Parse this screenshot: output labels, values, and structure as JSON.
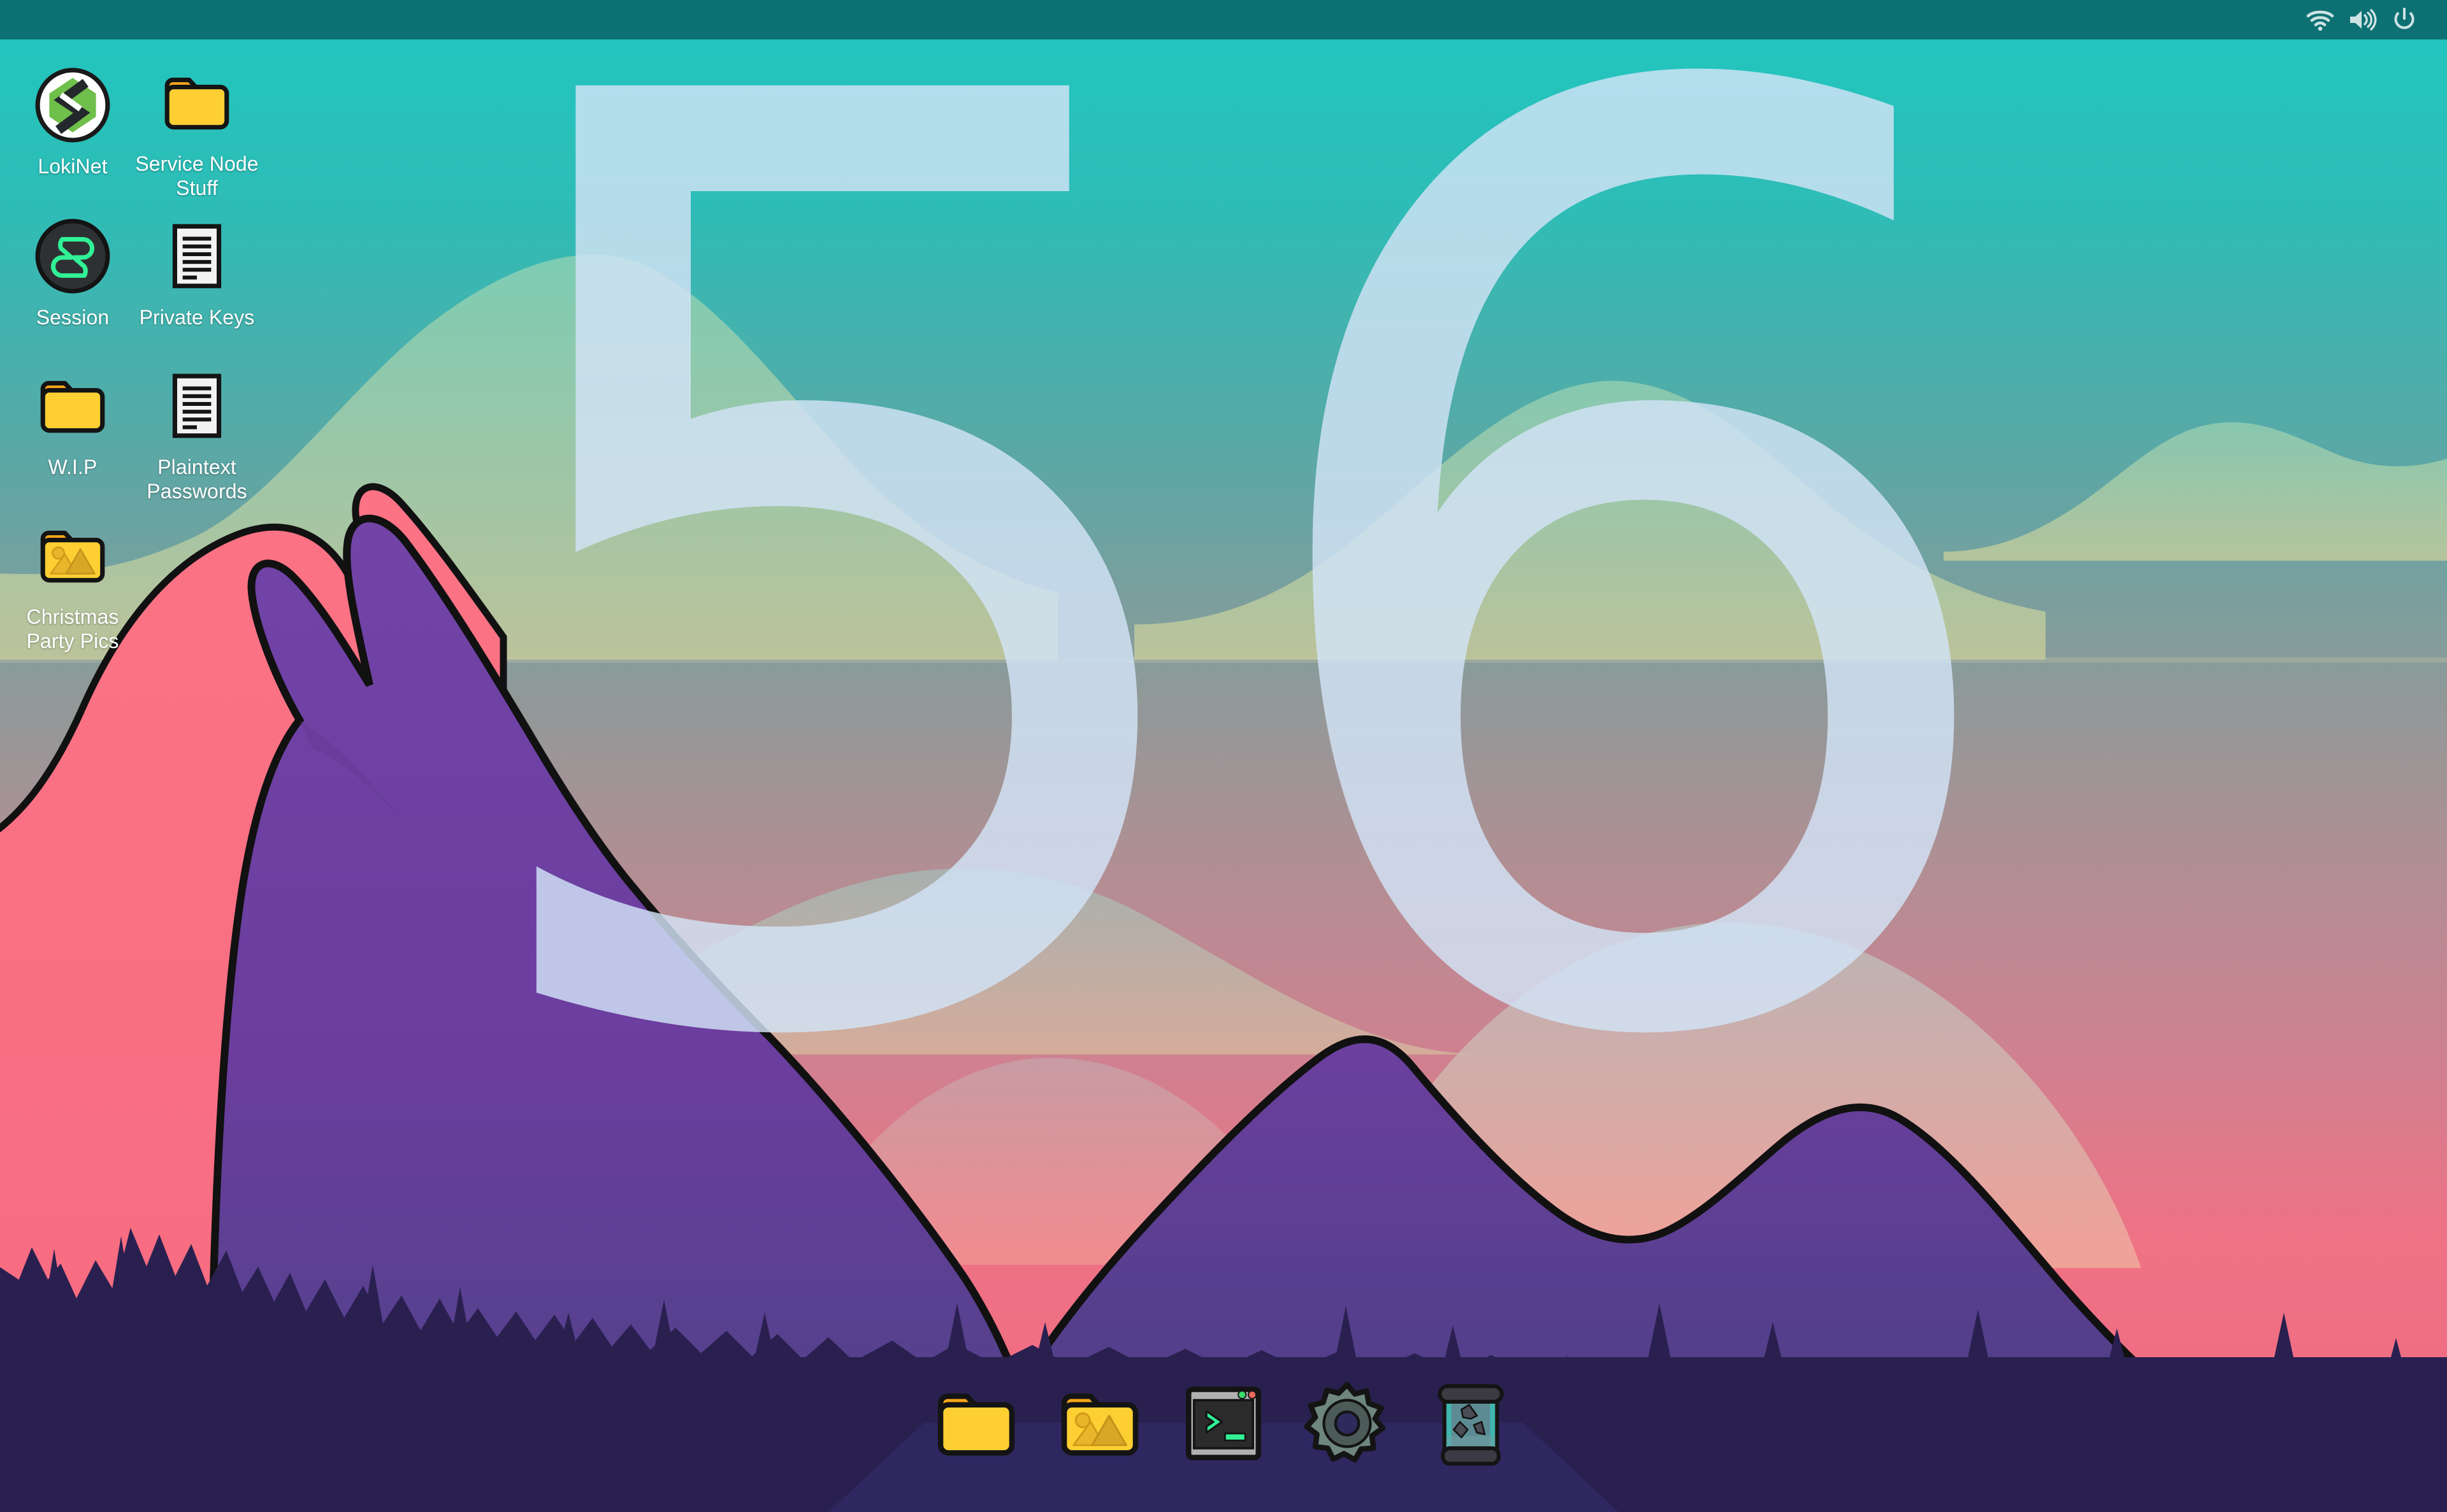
{
  "desktop": {
    "wallpaper_name": "retro-mountain-sunset",
    "overlay_number": "56",
    "colors": {
      "panel": "#0d7174",
      "sky_top": "#1fc7c0",
      "sky_mid": "#7fa2a6",
      "sky_bottom": "#f06c7e",
      "mountain_pink": "#fa7185",
      "mountain_purple": "#6b3d99",
      "forest": "#2a2050",
      "overlay_text": "#d3e4f7",
      "folder_yellow": "#fdcf33",
      "folder_tab": "#f9a61a",
      "accent_green": "#31f196",
      "lokinet_green": "#6fbf4b"
    }
  },
  "topbar": {
    "tray": [
      {
        "name": "wifi-icon",
        "label": "Network"
      },
      {
        "name": "volume-icon",
        "label": "Volume"
      },
      {
        "name": "power-icon",
        "label": "Power"
      }
    ]
  },
  "desktop_icons": [
    {
      "label": "LokiNet",
      "icon": "lokinet-app-icon",
      "col": 0,
      "row": 0
    },
    {
      "label": "Service Node Stuff",
      "icon": "folder-icon",
      "col": 1,
      "row": 0
    },
    {
      "label": "Session",
      "icon": "session-app-icon",
      "col": 0,
      "row": 1
    },
    {
      "label": "Private Keys",
      "icon": "document-icon",
      "col": 1,
      "row": 1
    },
    {
      "label": "W.I.P",
      "icon": "folder-icon",
      "col": 0,
      "row": 2
    },
    {
      "label": "Plaintext Passwords",
      "icon": "document-icon",
      "col": 1,
      "row": 2
    },
    {
      "label": "Christmas Party Pics",
      "icon": "pictures-folder-icon",
      "col": 0,
      "row": 3
    }
  ],
  "dock": {
    "items": [
      {
        "label": "Files",
        "icon": "folder-icon"
      },
      {
        "label": "Pictures",
        "icon": "pictures-folder-icon"
      },
      {
        "label": "Terminal",
        "icon": "terminal-icon"
      },
      {
        "label": "Settings",
        "icon": "gear-icon"
      },
      {
        "label": "Trash",
        "icon": "trash-icon"
      }
    ]
  }
}
